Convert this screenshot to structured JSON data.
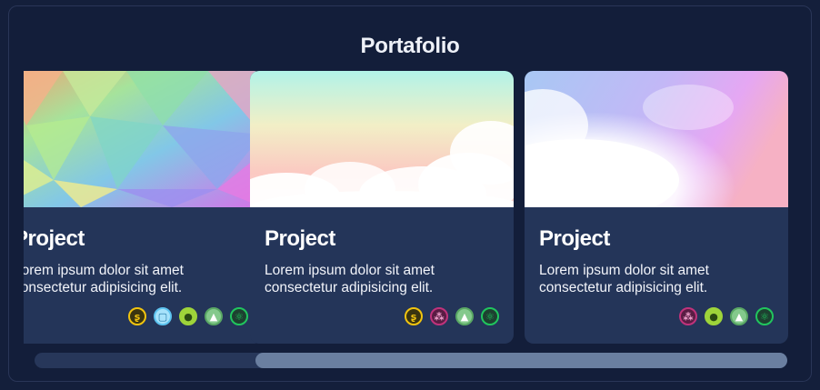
{
  "section_title": "Portafolio",
  "projects": [
    {
      "title": "Project",
      "description": "Lorem ipsum dolor sit amet consectetur adipisicing elit.",
      "image": "low-poly-rainbow",
      "tech_icons": [
        "sass-icon",
        "css-icon",
        "github-icon",
        "vue-icon",
        "react-icon"
      ]
    },
    {
      "title": "Project",
      "description": "Lorem ipsum dolor sit amet consectetur adipisicing elit.",
      "image": "pastel-clouds",
      "tech_icons": [
        "sass-icon",
        "figma-icon",
        "vue-icon",
        "react-icon"
      ]
    },
    {
      "title": "Project",
      "description": "Lorem ipsum dolor sit amet consectetur adipisicing elit.",
      "image": "pastel-smoke",
      "tech_icons": [
        "figma-icon",
        "github-icon",
        "vue-icon",
        "react-icon"
      ]
    }
  ],
  "scrollbar": {
    "position": 0.29
  },
  "colors": {
    "background": "#141f3b",
    "card": "#243559",
    "sass": "#f1c40f",
    "css": "#5dc4f0",
    "github": "#9ed43a",
    "vue": "#5aa864",
    "react": "#21c55d",
    "figma": "#c0337b"
  }
}
